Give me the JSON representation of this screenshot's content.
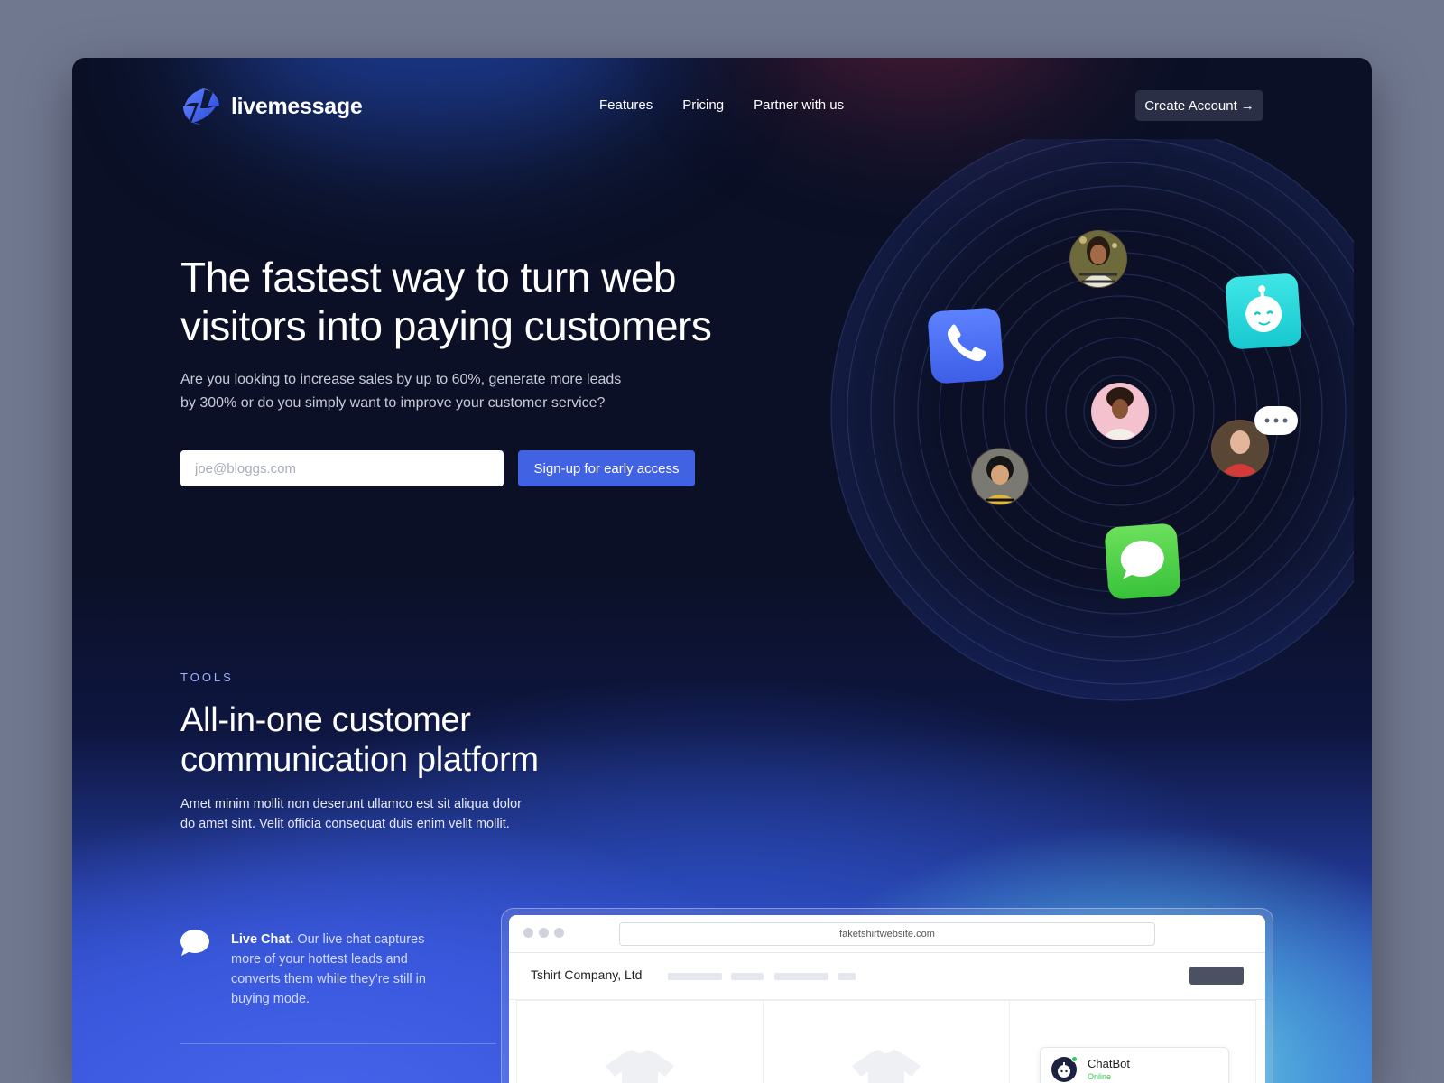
{
  "brand": {
    "name": "livemessage"
  },
  "nav": {
    "links": [
      "Features",
      "Pricing",
      "Partner with us"
    ],
    "cta_label": "Create Account",
    "cta_arrow": "→"
  },
  "hero": {
    "title_line1": "The fastest way to turn web",
    "title_line2": "visitors into paying customers",
    "subtitle_line1": "Are you looking to increase sales by up to 60%, generate more leads",
    "subtitle_line2": "by 300% or do you simply want to improve your customer service?",
    "email_placeholder": "joe@bloggs.com",
    "signup_label": "Sign-up for early access"
  },
  "orbit": {
    "icons": [
      "phone-app-icon",
      "robot-app-icon",
      "messages-app-icon"
    ],
    "avatars": [
      "avatar-woman-top",
      "avatar-woman-center",
      "avatar-woman-left",
      "avatar-man-right"
    ],
    "typing_bubble": "•••"
  },
  "tools": {
    "eyebrow": "TOOLS",
    "title_line1": "All-in-one customer",
    "title_line2": "communication platform",
    "desc_line1": "Amet minim mollit non deserunt ullamco est sit aliqua dolor",
    "desc_line2": "do amet sint. Velit officia consequat duis enim velit mollit.",
    "features": [
      {
        "title": "Live Chat.",
        "body": "Our live chat captures more of your hottest leads and converts them while they’re still in buying mode."
      }
    ]
  },
  "mockup": {
    "url": "faketshirtwebsite.com",
    "site_name": "Tshirt Company, Ltd",
    "chatbot_name": "ChatBot",
    "chatbot_status": "Online"
  },
  "colors": {
    "background": "#0b1026",
    "accent": "#4262e4",
    "page_surround": "#707890",
    "online": "#34c759"
  }
}
